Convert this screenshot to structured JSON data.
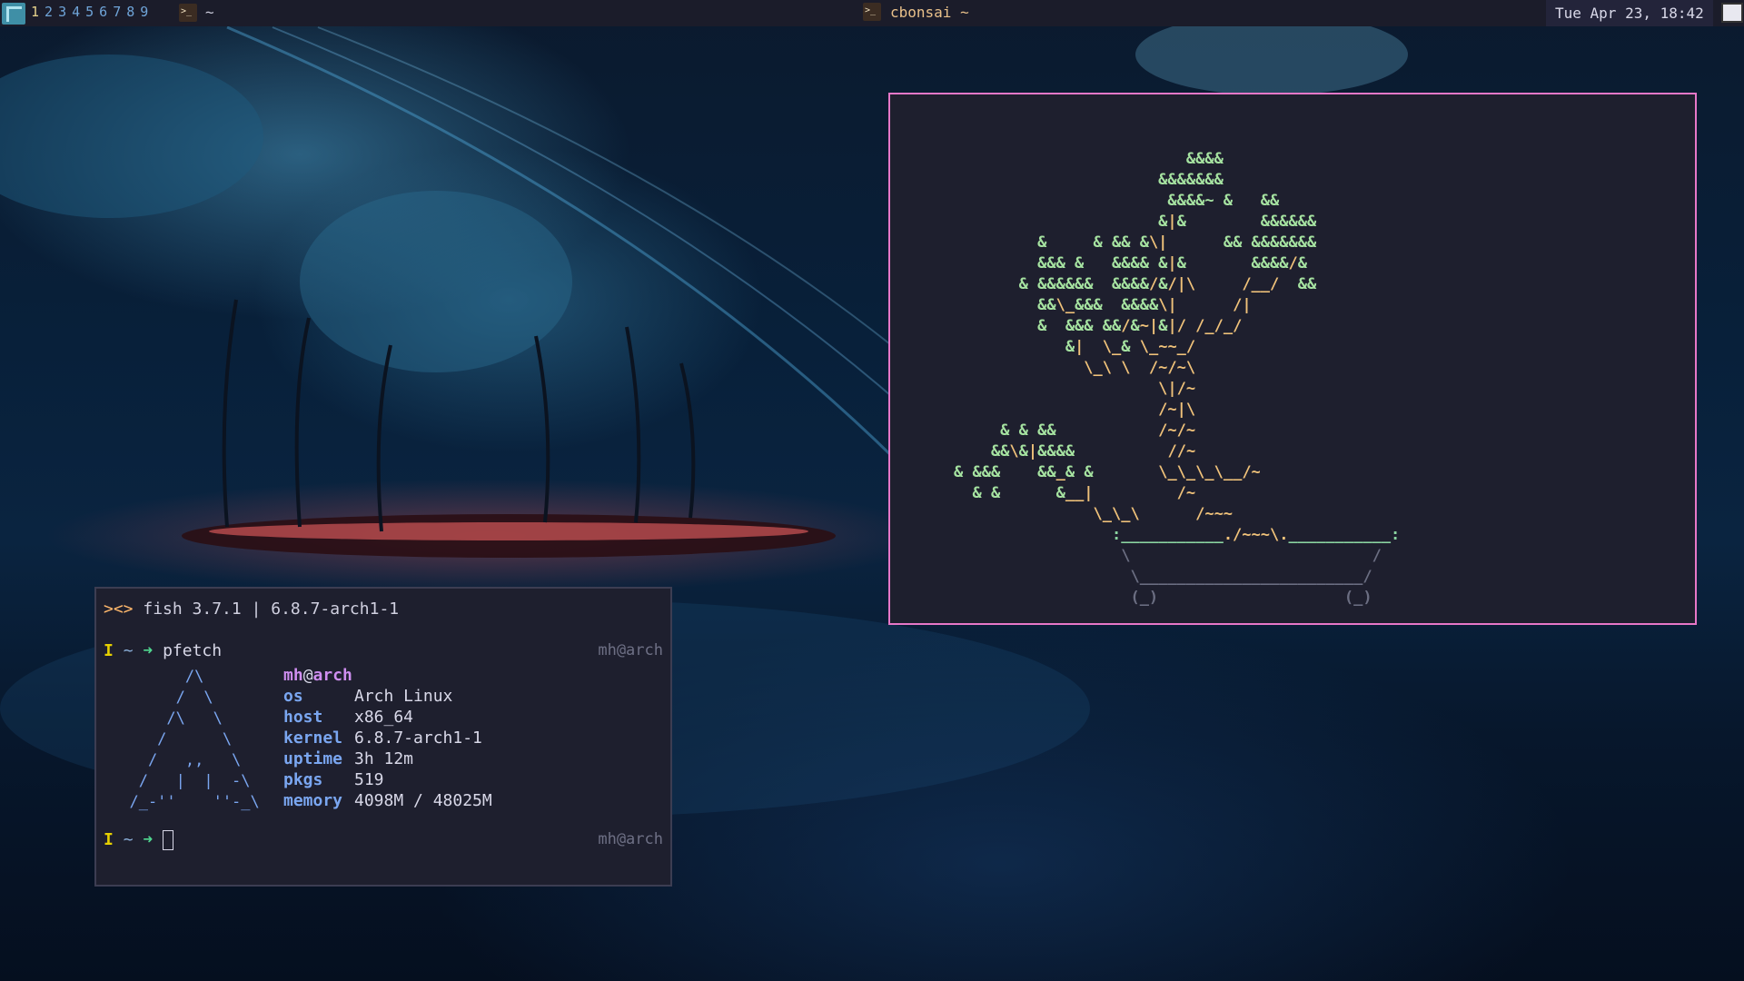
{
  "topbar": {
    "workspaces": [
      "1",
      "2",
      "3",
      "4",
      "5",
      "6",
      "7",
      "8",
      "9"
    ],
    "active_workspace_index": 0,
    "workspace_label": "~",
    "window_title": "cbonsai ~",
    "clock": "Tue Apr 23, 18:42"
  },
  "bonsai": {
    "lines": [
      "                  &&&& ",
      "               &&&&&&& ",
      "                &&&&~ &   && ",
      "               &|&        &&&&&& ",
      "  &     & && &\\|      && &&&&&&& ",
      "  &&& &   &&&& &|&       &&&&/& ",
      "& &&&&&&  &&&&/&/|\\     /__/  && ",
      "  &&\\_&&&  &&&&\\|      /| ",
      "  &  &&& &&/&~|&|/ /_/_/ ",
      "     &|  \\_& \\_~~_/ ",
      "       \\_\\ \\  /~/~\\ ",
      "               \\|/~ ",
      "               /~|\\ ",
      "              /~/~ ",
      "               //~ ",
      "  &&\\&|&&&&&    &__|  \\_\\_\\_\\__/~ ",
      "                \\_\\_\\          /~ ",
      "                              /~~~ ",
      "                             ./~~~\\. "
    ],
    "lower_left": [
      "&  & &&",
      "&&\\&|&&&&&",
      "& &&&    &&_& &",
      "&  &       &__|"
    ],
    "pot_top": ":___________./~~~\\.___________:",
    "pot_body": " \\                           / ",
    "pot_base": "  \\_________________________/ ",
    "pot_feet": "  (_)                     (_) "
  },
  "fish": {
    "header_logo": "><>",
    "header_text": "fish 3.7.1 | 6.8.7-arch1-1",
    "prompt_i": "I",
    "prompt_tilde": "~",
    "prompt_arrow": "➜",
    "command": "pfetch",
    "host_right": "mh@arch",
    "user": "mh",
    "at": "@",
    "host": "arch",
    "info": [
      {
        "key": "os",
        "value": "Arch Linux"
      },
      {
        "key": "host",
        "value": "x86_64"
      },
      {
        "key": "kernel",
        "value": "6.8.7-arch1-1"
      },
      {
        "key": "uptime",
        "value": "3h 12m"
      },
      {
        "key": "pkgs",
        "value": "519"
      },
      {
        "key": "memory",
        "value": "4098M / 48025M"
      }
    ],
    "arch_logo": "        /\\\n       /  \\\n      /\\   \\\n     /      \\\n    /   ,,   \\\n   /   |  |  -\\\n  /_-''    ''-_\\"
  },
  "colors": {
    "topbar_bg": "#1b1c2a",
    "bonsai_border": "#e777c8",
    "terminal_bg": "#1e1f2e",
    "leaf": "#a6e3a1",
    "trunk": "#f0c27a"
  }
}
